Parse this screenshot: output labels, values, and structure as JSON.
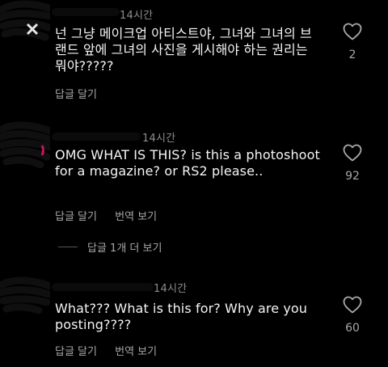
{
  "comments": [
    {
      "time": "14시간",
      "text": "넌 그냥 메이크업 아티스트야, 그녀와 그녀의 브랜드 앞에 그녀의 사진을 게시해야 하는 권리는 뭐야?????",
      "actions": {
        "reply": "답글 달기"
      },
      "likes": "2"
    },
    {
      "time": "14시간",
      "text": "OMG WHAT IS THIS? is this a photoshoot for a magazine? or RS2 please..",
      "actions": {
        "reply": "답글 달기",
        "translate": "번역 보기"
      },
      "likes": "92",
      "more_replies": "답글 1개 더 보기"
    },
    {
      "time": "14시간",
      "text": "What??? What is this for? Why are you posting????",
      "actions": {
        "reply": "답글 달기",
        "translate": "번역 보기"
      },
      "likes": "60"
    }
  ],
  "colors": {
    "background": "#000000",
    "primary_text": "#f5f5f5",
    "secondary_text": "#a8a8a8"
  },
  "icons": {
    "like": "heart-outline-icon"
  }
}
